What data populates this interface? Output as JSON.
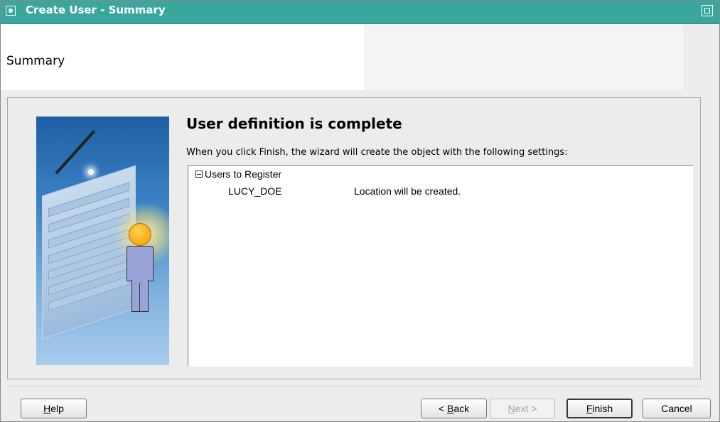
{
  "window": {
    "title": "Create User - Summary"
  },
  "header": {
    "title": "Summary"
  },
  "main": {
    "heading": "User definition is complete",
    "description": "When you click Finish, the wizard will create the object with the following settings:",
    "tree": {
      "group_label": "Users to Register",
      "items": [
        {
          "user": "LUCY_DOE",
          "status": "Location will be created."
        }
      ]
    }
  },
  "buttons": {
    "help": {
      "mnemonic": "H",
      "rest": "elp"
    },
    "back": {
      "prefix": "< ",
      "mnemonic": "B",
      "rest": "ack"
    },
    "next": {
      "mnemonic": "N",
      "rest": "ext >"
    },
    "finish": {
      "mnemonic": "F",
      "rest": "inish"
    },
    "cancel": "Cancel"
  },
  "colors": {
    "titlebar": "#3aa79f",
    "background": "#ededed"
  },
  "icons": {
    "window_menu": "window-menu-icon",
    "maximize": "maximize-icon",
    "tree_expander": "collapse-icon"
  }
}
